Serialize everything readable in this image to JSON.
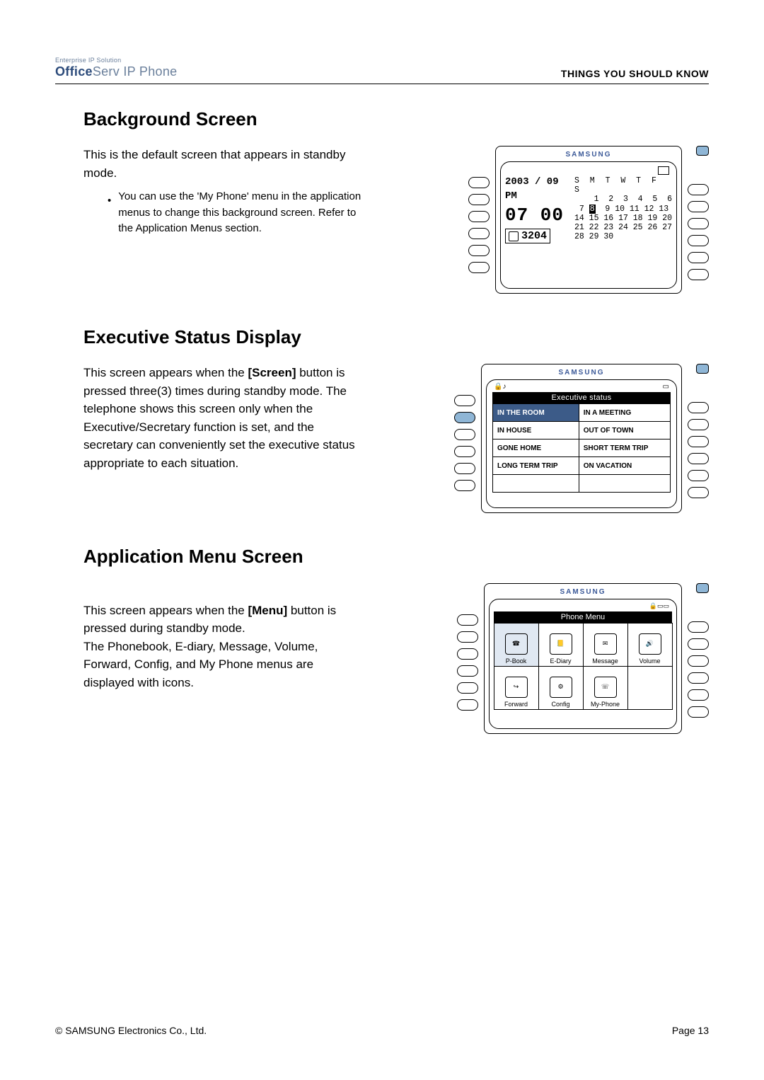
{
  "header": {
    "brand_sub": "Enterprise IP Solution",
    "brand_bold": "Office",
    "brand_thin": "Serv IP Phone",
    "right": "THINGS YOU SHOULD KNOW"
  },
  "section1": {
    "title": "Background Screen",
    "para": "This is the default screen that appears in standby mode.",
    "bullet": "You can use the 'My Phone' menu in the application menus to change this background screen. Refer to the Application Menus section.",
    "fig": {
      "brand": "SAMSUNG",
      "year": "2003 / 09",
      "pm": "PM",
      "time": "07 00",
      "ext": "3204",
      "cal_header": "S  M  T  W  T  F  S",
      "cal_r1": "    1  2  3  4  5  6",
      "cal_r2a": " 7 ",
      "cal_today": "8",
      "cal_r2b": "  9 10 11 12 13",
      "cal_r3": "14 15 16 17 18 19 20",
      "cal_r4": "21 22 23 24 25 26 27",
      "cal_r5": "28 29 30"
    }
  },
  "section2": {
    "title": "Executive Status Display",
    "para_a": "This screen appears when the ",
    "para_bold": "[Screen]",
    "para_b": " button is pressed three(3) times during standby mode. The telephone shows this screen only when the Executive/Secretary function is set, and the secretary can conveniently set the executive status appropriate to each situation.",
    "fig": {
      "brand": "SAMSUNG",
      "title": "Executive status",
      "rows": [
        [
          "IN THE ROOM",
          "IN A MEETING"
        ],
        [
          "IN HOUSE",
          "OUT OF TOWN"
        ],
        [
          "GONE HOME",
          "SHORT TERM TRIP"
        ],
        [
          "LONG TERM TRIP",
          "ON VACATION"
        ],
        [
          "",
          ""
        ]
      ]
    }
  },
  "section3": {
    "title": "Application Menu Screen",
    "para_a": "This screen appears when the ",
    "para_bold": "[Menu]",
    "para_b": " button is pressed during standby mode.\nThe Phonebook, E-diary, Message, Volume, Forward, Config, and My Phone menus are displayed with icons.",
    "fig": {
      "brand": "SAMSUNG",
      "title": "Phone Menu",
      "items": [
        "P-Book",
        "E-Diary",
        "Message",
        "Volume",
        "Forward",
        "Config",
        "My-Phone"
      ]
    }
  },
  "footer": {
    "left": "© SAMSUNG Electronics Co., Ltd.",
    "right": "Page 13"
  }
}
